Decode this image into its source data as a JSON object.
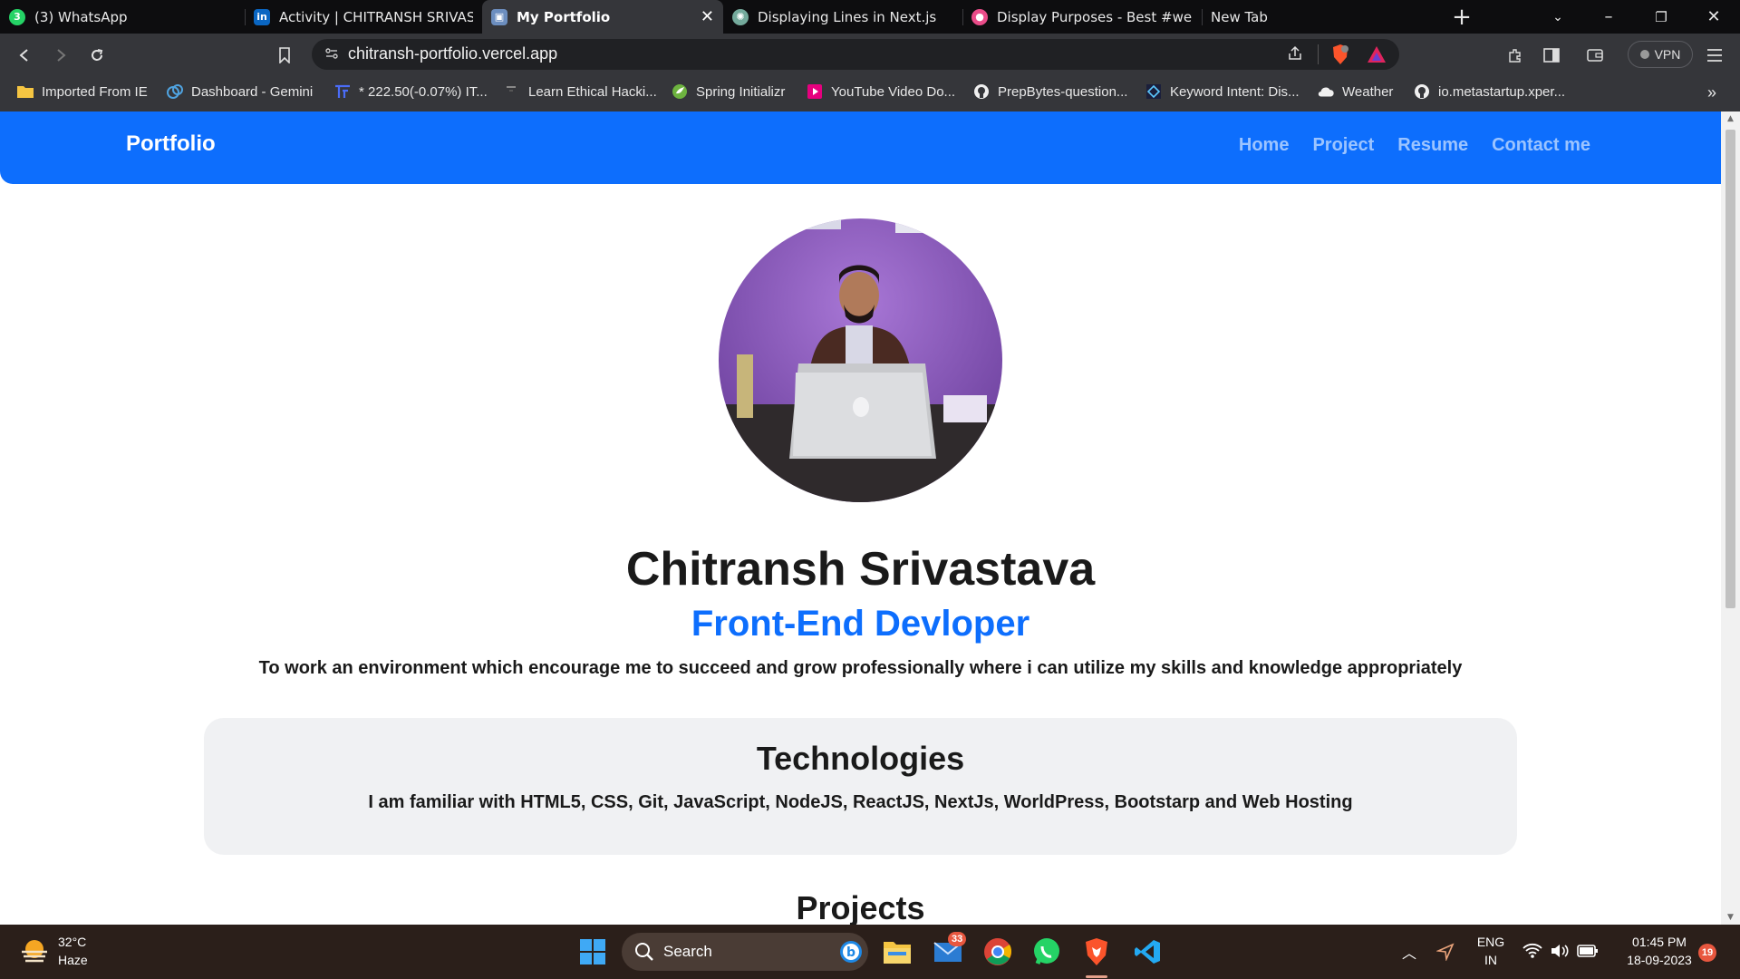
{
  "browser": {
    "tabs": [
      {
        "label": "(3) WhatsApp",
        "icon": "whatsapp-icon"
      },
      {
        "label": "Activity | CHITRANSH SRIVASTAVA",
        "icon": "linkedin-icon"
      },
      {
        "label": "My Portfolio",
        "icon": "portfolio-icon",
        "active": true
      },
      {
        "label": "Displaying Lines in Next.js",
        "icon": "chatgpt-icon"
      },
      {
        "label": "Display Purposes - Best #webdev",
        "icon": "dribbble-icon"
      },
      {
        "label": "New Tab",
        "icon": "none"
      }
    ],
    "address": "chitransh-portfolio.vercel.app",
    "vpn_label": "VPN",
    "bookmarks": [
      {
        "label": "Imported From IE",
        "icon": "folder-icon"
      },
      {
        "label": "Dashboard - Gemini",
        "icon": "gemini-icon"
      },
      {
        "label": "* 222.50(-0.07%) IT...",
        "icon": "ticker-icon"
      },
      {
        "label": "Learn Ethical Hacki...",
        "icon": "hacking-icon"
      },
      {
        "label": "Spring Initializr",
        "icon": "spring-icon"
      },
      {
        "label": "YouTube Video Do...",
        "icon": "youtube-icon"
      },
      {
        "label": "PrepBytes-question...",
        "icon": "github-icon"
      },
      {
        "label": "Keyword Intent: Dis...",
        "icon": "keyword-icon"
      },
      {
        "label": "Weather",
        "icon": "weather-icon"
      },
      {
        "label": "io.metastartup.xper...",
        "icon": "github-icon"
      }
    ]
  },
  "page": {
    "brand": "Portfolio",
    "nav": [
      "Home",
      "Project",
      "Resume",
      "Contact me"
    ],
    "name": "Chitransh Srivastava",
    "role": "Front-End Devloper",
    "objective": "To work an environment which encourage me to succeed and grow professionally where i can utilize my skills and knowledge appropriately",
    "technologies": {
      "title": "Technologies",
      "text": "I am familiar with HTML5, CSS, Git, JavaScript, NodeJS, ReactJS, NextJs, WorldPress, Bootstarp and Web Hosting"
    },
    "projects_title": "Projects"
  },
  "taskbar": {
    "temperature": "32°C",
    "weather": "Haze",
    "search_label": "Search",
    "mail_badge": "33",
    "language": "ENG",
    "region": "IN",
    "time": "01:45 PM",
    "date": "18-09-2023",
    "notification_count": "19"
  },
  "colors": {
    "accent": "#0d6efd",
    "tabstrip": "#0d0d0f",
    "toolbar": "#35363a",
    "taskbar": "#2b1f1a"
  }
}
